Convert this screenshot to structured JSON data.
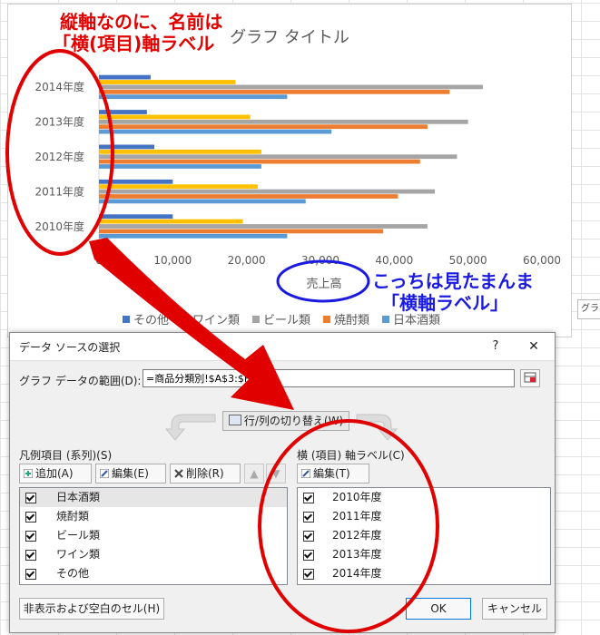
{
  "chart": {
    "title": "グラフ タイトル",
    "xlabel": "売上高",
    "tooltip": "グラフ"
  },
  "chart_data": {
    "type": "bar",
    "orientation": "horizontal",
    "title": "グラフ タイトル",
    "xlabel": "売上高",
    "ylabel": "",
    "categories": [
      "2010年度",
      "2011年度",
      "2012年度",
      "2013年度",
      "2014年度"
    ],
    "xlim": [
      0,
      60000
    ],
    "xticks": [
      "0",
      "10,000",
      "20,000",
      "30,000",
      "40,000",
      "50,000",
      "60,000"
    ],
    "legend_position": "bottom",
    "grid": false,
    "series": [
      {
        "name": "日本酒類",
        "color": "#5b9bd5",
        "values": [
          25500,
          28000,
          22000,
          31500,
          25500
        ]
      },
      {
        "name": "焼酎類",
        "color": "#ed7d31",
        "values": [
          38500,
          40500,
          43500,
          44500,
          47500
        ]
      },
      {
        "name": "ビール類",
        "color": "#a5a5a5",
        "values": [
          44500,
          45500,
          48500,
          50000,
          52000
        ]
      },
      {
        "name": "ワイン類",
        "color": "#ffc000",
        "values": [
          19500,
          21500,
          22000,
          20500,
          18500
        ]
      },
      {
        "name": "その他",
        "color": "#4472c4",
        "values": [
          10000,
          10000,
          7500,
          6500,
          7000
        ]
      }
    ],
    "legend_order": [
      "その他",
      "ワイン類",
      "ビール類",
      "焼酎類",
      "日本酒類"
    ]
  },
  "dialog": {
    "title": "データ ソースの選択",
    "help": "?",
    "close": "✕",
    "range_label": "グラフ データの範囲(D):",
    "range_value": "=商品分類別!$A$3:$F$8",
    "switch_label": "行/列の切り替え(W)",
    "legend_label": "凡例項目 (系列)(S)",
    "axis_label": "横 (項目) 軸ラベル(C)",
    "add_label": "追加(A)",
    "edit_label": "編集(E)",
    "delete_label": "削除(R)",
    "up_arrow": "▲",
    "down_arrow": "▼",
    "axis_edit_label": "編集(T)",
    "legend_items": [
      "日本酒類",
      "焼酎類",
      "ビール類",
      "ワイン類",
      "その他"
    ],
    "axis_items": [
      "2010年度",
      "2011年度",
      "2012年度",
      "2013年度",
      "2014年度"
    ],
    "hidden_cells": "非表示および空白のセル(H)",
    "ok": "OK",
    "cancel": "キャンセル"
  },
  "annotations": {
    "top_line1": "縦軸なのに、名前は",
    "top_line2": "「横(項目)軸ラベル",
    "right_line1": "こっちは見たまんま",
    "right_line2": "「横軸ラベル」"
  },
  "colors": {
    "annotation_red": "#e00000",
    "annotation_blue": "#1a1ae0"
  }
}
